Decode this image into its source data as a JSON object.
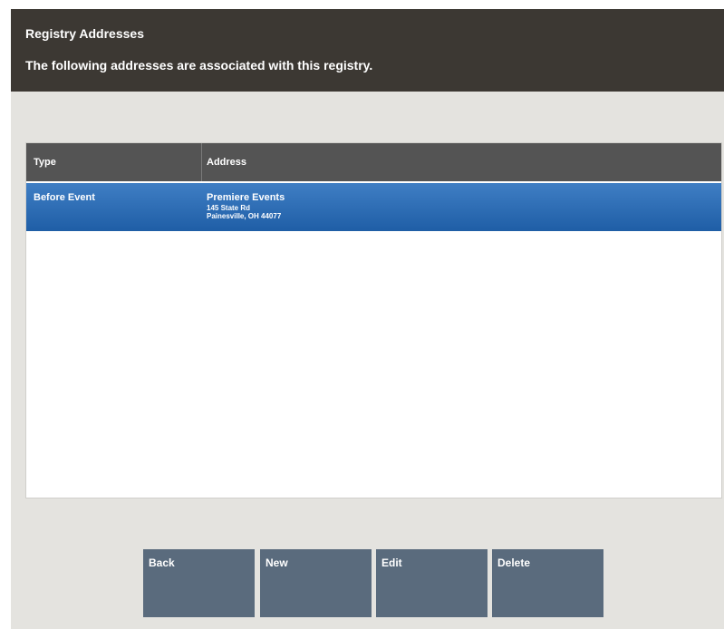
{
  "header": {
    "title": "Registry Addresses",
    "subtitle": "The following addresses are associated with this registry."
  },
  "table": {
    "columns": [
      "Type",
      "Address"
    ],
    "rows": [
      {
        "type": "Before Event",
        "address_name": "Premiere Events",
        "address_line1": "145 State Rd",
        "address_line2": "Painesville, OH 44077",
        "selected": true
      }
    ]
  },
  "buttons": {
    "back": "Back",
    "new": "New",
    "edit": "Edit",
    "delete": "Delete"
  },
  "colors": {
    "header_bg": "#3c3833",
    "selected_row": "#2a68b0",
    "button_bg": "#5a6b7d",
    "panel_bg": "#e4e3df"
  }
}
